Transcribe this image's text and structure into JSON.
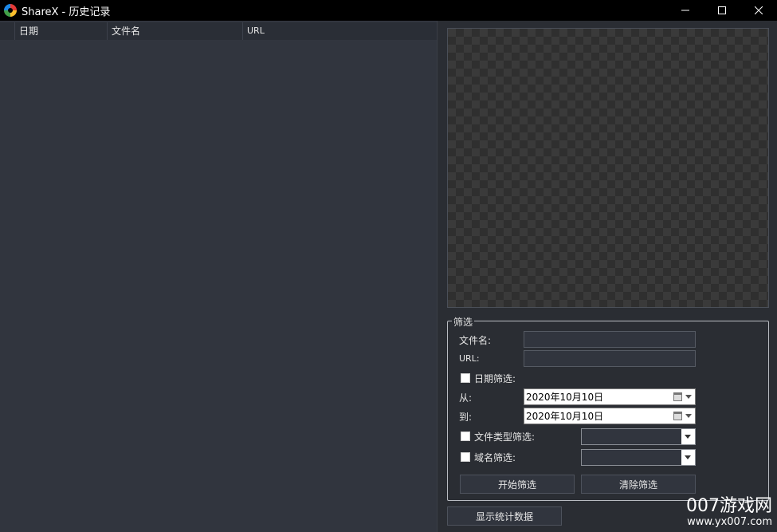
{
  "window": {
    "title": "ShareX - 历史记录",
    "minimize_glyph": "—",
    "maximize_glyph": "☐",
    "close_glyph": "✕"
  },
  "list": {
    "columns": [
      "日期",
      "文件名",
      "URL"
    ]
  },
  "filter": {
    "group_label": "筛选",
    "filename_label": "文件名:",
    "filename_value": "",
    "url_label": "URL:",
    "url_value": "",
    "date_filter_label": "日期筛选:",
    "from_label": "从:",
    "from_date": "2020年10月10日",
    "to_label": "到:",
    "to_date": "2020年10月10日",
    "filetype_filter_label": "文件类型筛选:",
    "filetype_value": "",
    "domain_filter_label": "域名筛选:",
    "domain_value": "",
    "apply_button": "开始筛选",
    "clear_button": "清除筛选"
  },
  "stats_button": "显示统计数据",
  "watermark": {
    "main": "007游戏网",
    "sub": "www.yx007.com"
  }
}
